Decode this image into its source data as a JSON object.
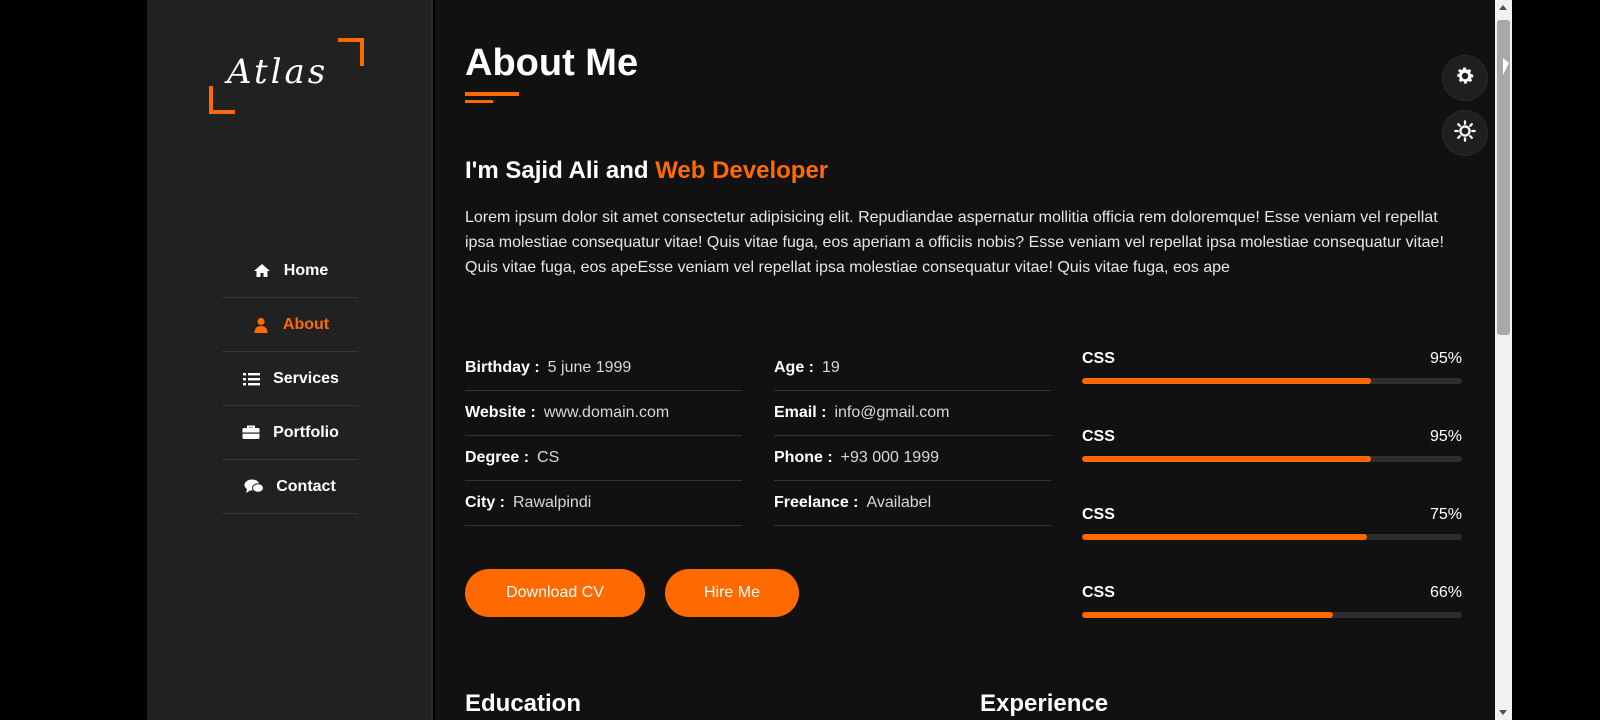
{
  "brand": {
    "logo_text": "Atlas"
  },
  "nav": {
    "items": [
      {
        "label": "Home",
        "icon": "home-icon",
        "active": false
      },
      {
        "label": "About",
        "icon": "user-icon",
        "active": true
      },
      {
        "label": "Services",
        "icon": "list-icon",
        "active": false
      },
      {
        "label": "Portfolio",
        "icon": "briefcase-icon",
        "active": false
      },
      {
        "label": "Contact",
        "icon": "chat-icon",
        "active": false
      }
    ]
  },
  "about": {
    "title": "About Me",
    "heading_prefix": "I'm Sajid Ali and",
    "heading_highlight": "Web Developer",
    "paragraph": "Lorem ipsum dolor sit amet consectetur adipisicing elit. Repudiandae aspernatur mollitia officia rem doloremque! Esse veniam vel repellat ipsa molestiae consequatur vitae! Quis vitae fuga, eos aperiam a officiis nobis? Esse veniam vel repellat ipsa molestiae consequatur vitae! Quis vitae fuga, eos apeEsse veniam vel repellat ipsa molestiae consequatur vitae! Quis vitae fuga, eos ape"
  },
  "info": {
    "left": [
      {
        "key": "Birthday :",
        "value": "5 june 1999"
      },
      {
        "key": "Website :",
        "value": "www.domain.com"
      },
      {
        "key": "Degree :",
        "value": "CS"
      },
      {
        "key": "City :",
        "value": "Rawalpindi"
      }
    ],
    "right": [
      {
        "key": "Age :",
        "value": "19"
      },
      {
        "key": "Email :",
        "value": "info@gmail.com"
      },
      {
        "key": "Phone :",
        "value": "+93 000 1999"
      },
      {
        "key": "Freelance :",
        "value": "Availabel"
      }
    ]
  },
  "buttons": {
    "download_cv": "Download CV",
    "hire_me": "Hire Me"
  },
  "skills": [
    {
      "name": "CSS",
      "percent_label": "95%",
      "level": 0.76
    },
    {
      "name": "CSS",
      "percent_label": "95%",
      "level": 0.76
    },
    {
      "name": "CSS",
      "percent_label": "75%",
      "level": 0.75
    },
    {
      "name": "CSS",
      "percent_label": "66%",
      "level": 0.66
    }
  ],
  "sections": {
    "education": "Education",
    "experience": "Experience"
  },
  "colors": {
    "accent": "#ff6a00",
    "sidebar_bg": "#202222",
    "main_bg": "#111111"
  }
}
